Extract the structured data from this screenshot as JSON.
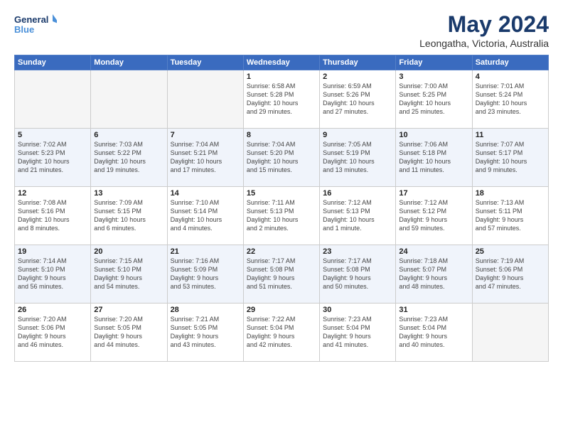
{
  "logo": {
    "line1": "General",
    "line2": "Blue"
  },
  "title": "May 2024",
  "subtitle": "Leongatha, Victoria, Australia",
  "weekdays": [
    "Sunday",
    "Monday",
    "Tuesday",
    "Wednesday",
    "Thursday",
    "Friday",
    "Saturday"
  ],
  "weeks": [
    [
      {
        "day": "",
        "info": ""
      },
      {
        "day": "",
        "info": ""
      },
      {
        "day": "",
        "info": ""
      },
      {
        "day": "1",
        "info": "Sunrise: 6:58 AM\nSunset: 5:28 PM\nDaylight: 10 hours\nand 29 minutes."
      },
      {
        "day": "2",
        "info": "Sunrise: 6:59 AM\nSunset: 5:26 PM\nDaylight: 10 hours\nand 27 minutes."
      },
      {
        "day": "3",
        "info": "Sunrise: 7:00 AM\nSunset: 5:25 PM\nDaylight: 10 hours\nand 25 minutes."
      },
      {
        "day": "4",
        "info": "Sunrise: 7:01 AM\nSunset: 5:24 PM\nDaylight: 10 hours\nand 23 minutes."
      }
    ],
    [
      {
        "day": "5",
        "info": "Sunrise: 7:02 AM\nSunset: 5:23 PM\nDaylight: 10 hours\nand 21 minutes."
      },
      {
        "day": "6",
        "info": "Sunrise: 7:03 AM\nSunset: 5:22 PM\nDaylight: 10 hours\nand 19 minutes."
      },
      {
        "day": "7",
        "info": "Sunrise: 7:04 AM\nSunset: 5:21 PM\nDaylight: 10 hours\nand 17 minutes."
      },
      {
        "day": "8",
        "info": "Sunrise: 7:04 AM\nSunset: 5:20 PM\nDaylight: 10 hours\nand 15 minutes."
      },
      {
        "day": "9",
        "info": "Sunrise: 7:05 AM\nSunset: 5:19 PM\nDaylight: 10 hours\nand 13 minutes."
      },
      {
        "day": "10",
        "info": "Sunrise: 7:06 AM\nSunset: 5:18 PM\nDaylight: 10 hours\nand 11 minutes."
      },
      {
        "day": "11",
        "info": "Sunrise: 7:07 AM\nSunset: 5:17 PM\nDaylight: 10 hours\nand 9 minutes."
      }
    ],
    [
      {
        "day": "12",
        "info": "Sunrise: 7:08 AM\nSunset: 5:16 PM\nDaylight: 10 hours\nand 8 minutes."
      },
      {
        "day": "13",
        "info": "Sunrise: 7:09 AM\nSunset: 5:15 PM\nDaylight: 10 hours\nand 6 minutes."
      },
      {
        "day": "14",
        "info": "Sunrise: 7:10 AM\nSunset: 5:14 PM\nDaylight: 10 hours\nand 4 minutes."
      },
      {
        "day": "15",
        "info": "Sunrise: 7:11 AM\nSunset: 5:13 PM\nDaylight: 10 hours\nand 2 minutes."
      },
      {
        "day": "16",
        "info": "Sunrise: 7:12 AM\nSunset: 5:13 PM\nDaylight: 10 hours\nand 1 minute."
      },
      {
        "day": "17",
        "info": "Sunrise: 7:12 AM\nSunset: 5:12 PM\nDaylight: 9 hours\nand 59 minutes."
      },
      {
        "day": "18",
        "info": "Sunrise: 7:13 AM\nSunset: 5:11 PM\nDaylight: 9 hours\nand 57 minutes."
      }
    ],
    [
      {
        "day": "19",
        "info": "Sunrise: 7:14 AM\nSunset: 5:10 PM\nDaylight: 9 hours\nand 56 minutes."
      },
      {
        "day": "20",
        "info": "Sunrise: 7:15 AM\nSunset: 5:10 PM\nDaylight: 9 hours\nand 54 minutes."
      },
      {
        "day": "21",
        "info": "Sunrise: 7:16 AM\nSunset: 5:09 PM\nDaylight: 9 hours\nand 53 minutes."
      },
      {
        "day": "22",
        "info": "Sunrise: 7:17 AM\nSunset: 5:08 PM\nDaylight: 9 hours\nand 51 minutes."
      },
      {
        "day": "23",
        "info": "Sunrise: 7:17 AM\nSunset: 5:08 PM\nDaylight: 9 hours\nand 50 minutes."
      },
      {
        "day": "24",
        "info": "Sunrise: 7:18 AM\nSunset: 5:07 PM\nDaylight: 9 hours\nand 48 minutes."
      },
      {
        "day": "25",
        "info": "Sunrise: 7:19 AM\nSunset: 5:06 PM\nDaylight: 9 hours\nand 47 minutes."
      }
    ],
    [
      {
        "day": "26",
        "info": "Sunrise: 7:20 AM\nSunset: 5:06 PM\nDaylight: 9 hours\nand 46 minutes."
      },
      {
        "day": "27",
        "info": "Sunrise: 7:20 AM\nSunset: 5:05 PM\nDaylight: 9 hours\nand 44 minutes."
      },
      {
        "day": "28",
        "info": "Sunrise: 7:21 AM\nSunset: 5:05 PM\nDaylight: 9 hours\nand 43 minutes."
      },
      {
        "day": "29",
        "info": "Sunrise: 7:22 AM\nSunset: 5:04 PM\nDaylight: 9 hours\nand 42 minutes."
      },
      {
        "day": "30",
        "info": "Sunrise: 7:23 AM\nSunset: 5:04 PM\nDaylight: 9 hours\nand 41 minutes."
      },
      {
        "day": "31",
        "info": "Sunrise: 7:23 AM\nSunset: 5:04 PM\nDaylight: 9 hours\nand 40 minutes."
      },
      {
        "day": "",
        "info": ""
      }
    ]
  ]
}
